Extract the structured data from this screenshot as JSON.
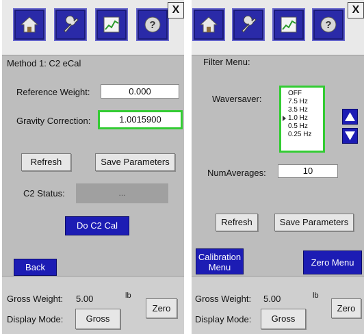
{
  "left": {
    "close_label": "X",
    "title": "Method 1: C2 eCal",
    "reference_weight_label": "Reference Weight:",
    "reference_weight_value": "0.000",
    "gravity_label": "Gravity Correction:",
    "gravity_value": "1.0015900",
    "refresh_label": "Refresh",
    "save_label": "Save Parameters",
    "c2_status_label": "C2 Status:",
    "c2_status_value": "...",
    "do_cal_label": "Do C2 Cal",
    "back_label": "Back",
    "gross_weight_label": "Gross Weight:",
    "gross_weight_value": "5.00",
    "unit": "lb",
    "zero_label": "Zero",
    "display_mode_label": "Display Mode:",
    "display_mode_value": "Gross"
  },
  "right": {
    "close_label": "X",
    "title": "Filter Menu:",
    "wavesaver_label": "Waversaver:",
    "wavesaver_options": [
      "OFF",
      "7.5 Hz",
      "3.5 Hz",
      "1.0 Hz",
      "0.5 Hz",
      "0.25 Hz"
    ],
    "wavesaver_selected": "1.0 Hz",
    "numaverages_label": "NumAverages:",
    "numaverages_value": "10",
    "refresh_label": "Refresh",
    "save_label": "Save Parameters",
    "calibration_label_1": "Calibration",
    "calibration_label_2": "Menu",
    "zero_menu_label": "Zero Menu",
    "gross_weight_label": "Gross Weight:",
    "gross_weight_value": "5.00",
    "unit": "lb",
    "zero_label": "Zero",
    "display_mode_label": "Display Mode:",
    "display_mode_value": "Gross"
  },
  "toolbar_icons": [
    "home-icon",
    "wrench-icon",
    "chart-icon",
    "help-icon"
  ],
  "colors": {
    "toolbar_blue": "#2a2aa8",
    "button_blue": "#1c1cb4",
    "highlight_green": "#33cc33",
    "panel_gray": "#bdbdbd"
  }
}
